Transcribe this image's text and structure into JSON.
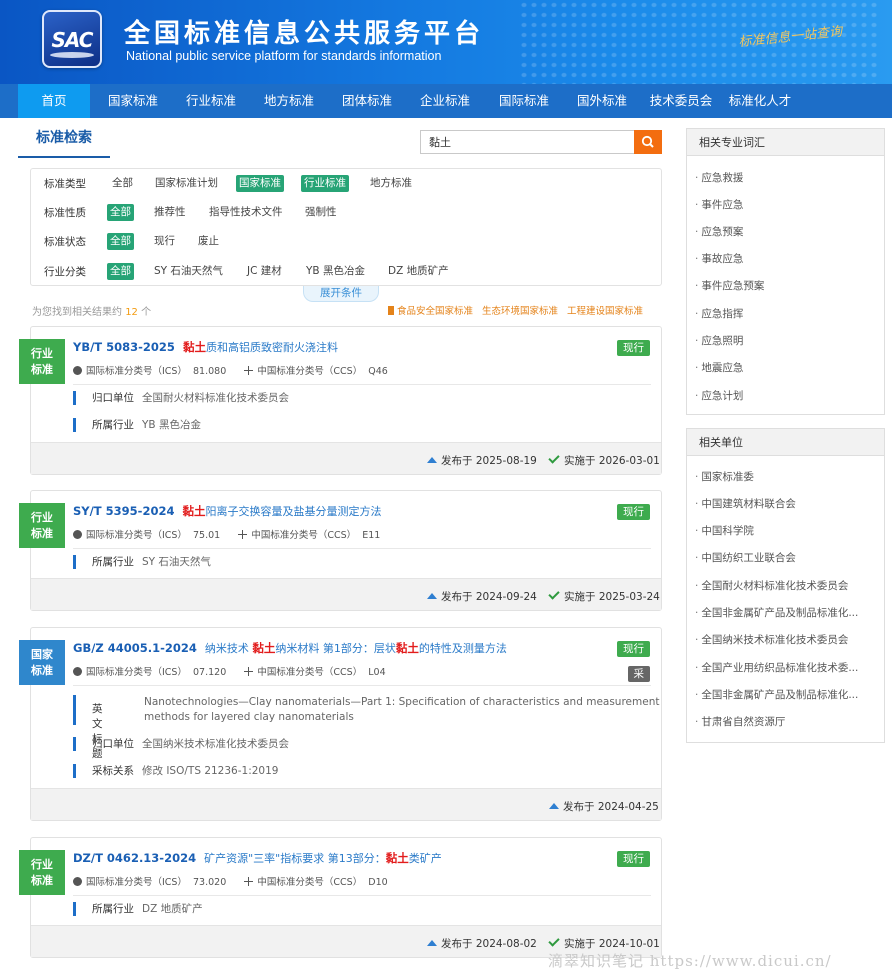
{
  "header": {
    "logo_text": "SAC",
    "title": "全国标准信息公共服务平台",
    "subtitle": "National public service platform  for standards information",
    "slogan": "标准信息一站查询"
  },
  "nav": [
    "首页",
    "国家标准",
    "行业标准",
    "地方标准",
    "团体标准",
    "企业标准",
    "国际标准",
    "国外标准",
    "技术委员会",
    "标准化人才"
  ],
  "search": {
    "tab_label": "标准检索",
    "query": "黏土"
  },
  "filters": {
    "type": {
      "label": "标准类型",
      "options": [
        "全部",
        "国家标准计划",
        "国家标准",
        "行业标准",
        "地方标准"
      ]
    },
    "nature": {
      "label": "标准性质",
      "options": [
        "全部",
        "推荐性",
        "指导性技术文件",
        "强制性"
      ]
    },
    "status": {
      "label": "标准状态",
      "options": [
        "全部",
        "现行",
        "废止"
      ]
    },
    "industry": {
      "label": "行业分类",
      "options": [
        "全部",
        "SY 石油天然气",
        "JC 建材",
        "YB 黑色冶金",
        "DZ 地质矿产"
      ]
    },
    "expand_label": "展开条件"
  },
  "results": {
    "prefix": "为您找到相关结果约",
    "count": "12",
    "suffix": "个",
    "quick_links": [
      "食品安全国家标准",
      "生态环境国家标准",
      "工程建设国家标准"
    ]
  },
  "cards": [
    {
      "badge": [
        "行业",
        "标准"
      ],
      "code": "YB/T 5083-2025",
      "title_hl": "黏土",
      "title_rest": "质和高铝质致密耐火浇注料",
      "status": "现行",
      "ics_label": "国际标准分类号（ICS）",
      "ics": "81.080",
      "ccs_label": "中国标准分类号（CCS）",
      "ccs": "Q46",
      "owner_label": "归口单位",
      "owner": "全国耐火材料标准化技术委员会",
      "industry_label": "所属行业",
      "industry": "YB 黑色冶金",
      "publish": "发布于 2025-08-19",
      "implement": "实施于 2026-03-01"
    },
    {
      "badge": [
        "行业",
        "标准"
      ],
      "code": "SY/T 5395-2024",
      "title_hl": "黏土",
      "title_rest": "阳离子交换容量及盐基分量测定方法",
      "status": "现行",
      "ics_label": "国际标准分类号（ICS）",
      "ics": "75.01",
      "ccs_label": "中国标准分类号（CCS）",
      "ccs": "E11",
      "industry_label": "所属行业",
      "industry": "SY 石油天然气",
      "publish": "发布于 2024-09-24",
      "implement": "实施于 2025-03-24"
    },
    {
      "badge": [
        "国家",
        "标准"
      ],
      "code": "GB/Z 44005.1-2024",
      "title_a": "纳米技术 ",
      "title_hl": "黏土",
      "title_b": "纳米材料 第1部分：层状",
      "title_hl2": "黏土",
      "title_c": "的特性及测量方法",
      "status": "现行",
      "status2": "采",
      "ics_label": "国际标准分类号（ICS）",
      "ics": "07.120",
      "ccs_label": "中国标准分类号（CCS）",
      "ccs": "L04",
      "en_label": "英文标题",
      "en_title": "Nanotechnologies—Clay nanomaterials—Part 1: Specification of characteristics and measurement methods for layered clay nanomaterials",
      "owner_label": "归口单位",
      "owner": "全国纳米技术标准化技术委员会",
      "adopt_label": "采标关系",
      "adopt": "修改  ISO/TS 21236-1:2019",
      "publish": "发布于 2024-04-25"
    },
    {
      "badge": [
        "行业",
        "标准"
      ],
      "code": "DZ/T 0462.13-2024",
      "title_a": "矿产资源\"三率\"指标要求 第13部分：",
      "title_hl": "黏土",
      "title_b": "类矿产",
      "status": "现行",
      "ics_label": "国际标准分类号（ICS）",
      "ics": "73.020",
      "ccs_label": "中国标准分类号（CCS）",
      "ccs": "D10",
      "industry_label": "所属行业",
      "industry": "DZ 地质矿产",
      "publish": "发布于 2024-08-02",
      "implement": "实施于 2024-10-01"
    }
  ],
  "sidebar": {
    "terms_title": "相关专业词汇",
    "terms": [
      "应急救援",
      "事件应急",
      "应急预案",
      "事故应急",
      "事件应急预案",
      "应急指挥",
      "应急照明",
      "地震应急",
      "应急计划"
    ],
    "units_title": "相关单位",
    "units": [
      "国家标准委",
      "中国建筑材料联合会",
      "中国科学院",
      "中国纺织工业联合会",
      "全国耐火材料标准化技术委员会",
      "全国非金属矿产品及制品标准化...",
      "全国纳米技术标准化技术委员会",
      "全国产业用纺织品标准化技术委...",
      "全国非金属矿产品及制品标准化...",
      "甘肃省自然资源厅"
    ]
  },
  "watermark": "滴翠知识笔记 https://www.dicui.cn/"
}
